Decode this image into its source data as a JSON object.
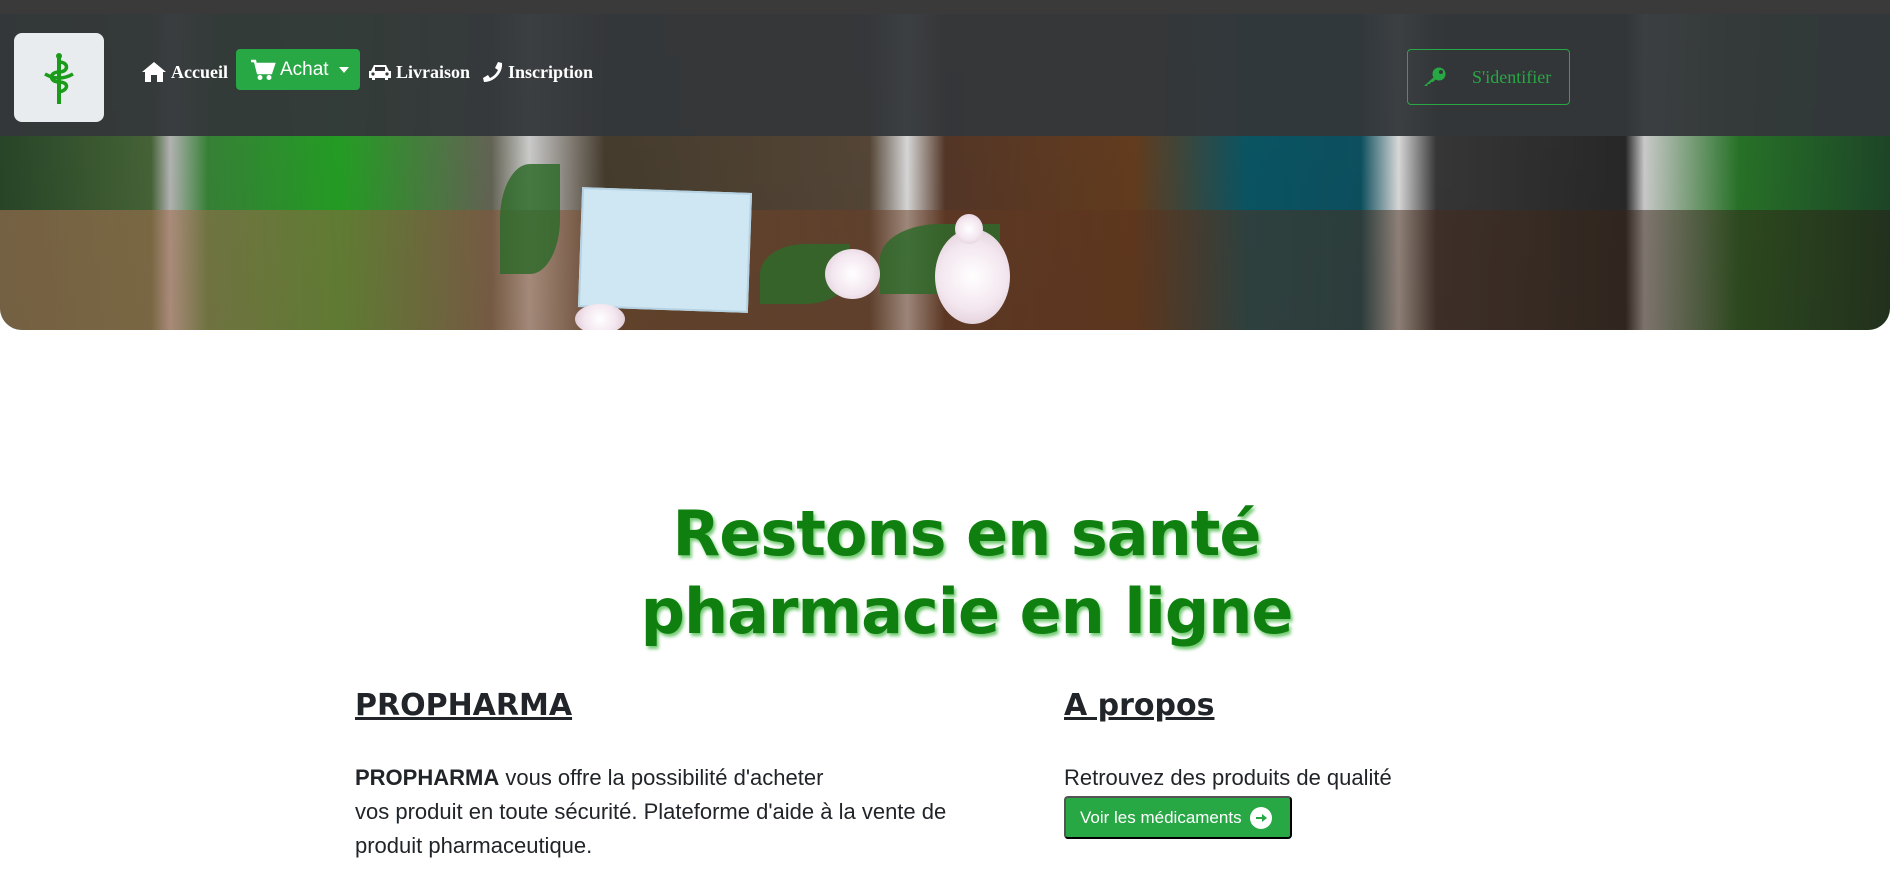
{
  "nav": {
    "accueil": "Accueil",
    "achat": "Achat",
    "livraison": "Livraison",
    "inscription": "Inscription",
    "login": "S'identifier"
  },
  "hero": {
    "line1": "Restons en santé",
    "line2": "pharmacie en ligne"
  },
  "propharma": {
    "title": "PROPHARMA",
    "brand_bold": "PROPHARMA",
    "line1_rest": " vous offre la possibilité d'acheter",
    "line2": "vos produit en toute sécurité. Plateforme d'aide à la vente de",
    "line3": "produit pharmaceutique."
  },
  "apropos": {
    "title": "A propos",
    "text": "Retrouvez des produits de qualité",
    "button": "Voir les médicaments"
  },
  "colors": {
    "accent": "#28a745",
    "headline": "#0f7f0f",
    "navbar": "#34373a"
  },
  "icons": [
    "pharmacy-logo-icon",
    "home-icon",
    "cart-icon",
    "car-icon",
    "phone-icon",
    "key-icon",
    "arrow-circle-right-icon"
  ]
}
